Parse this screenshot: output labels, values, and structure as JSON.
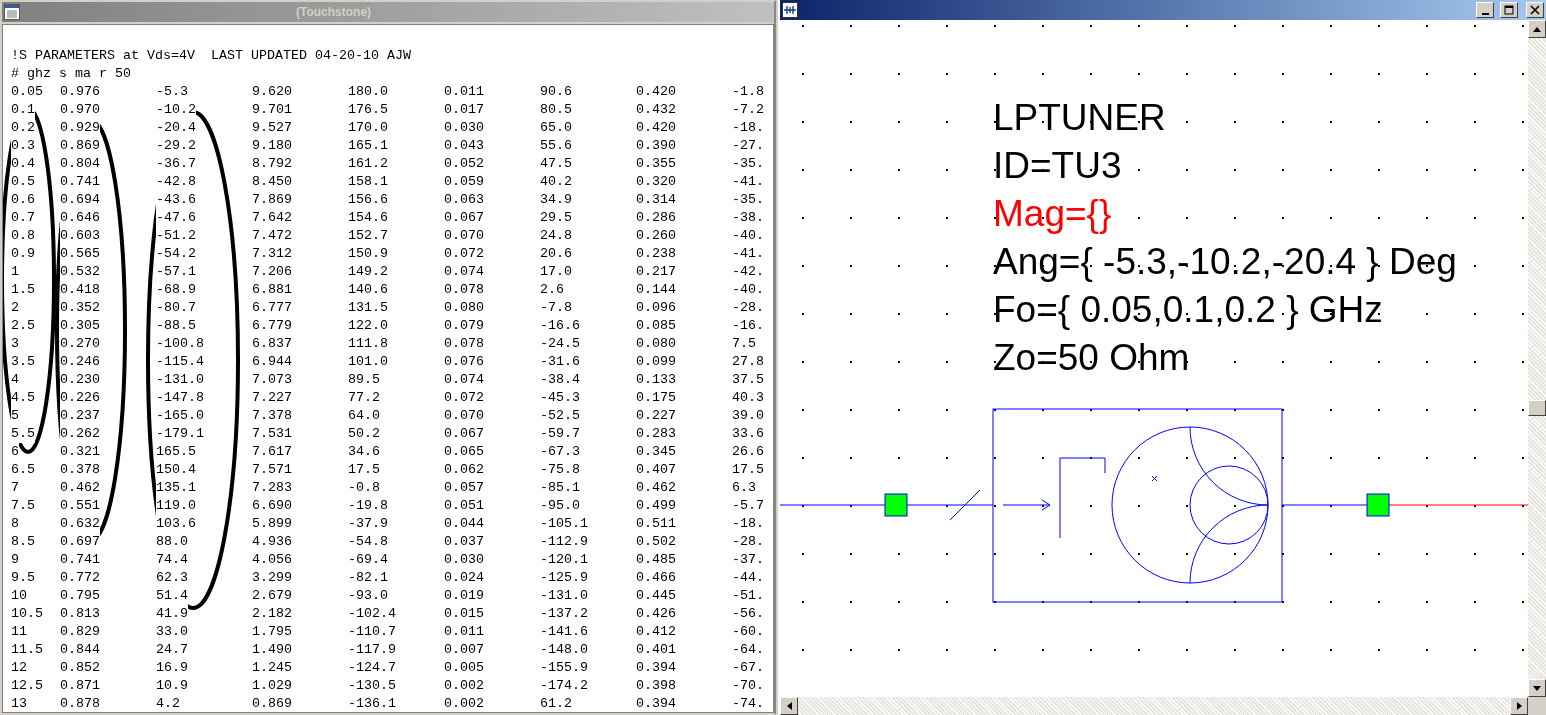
{
  "touchstone_window": {
    "title": "(Touchstone)",
    "active": false,
    "header_lines": [
      "!S PARAMETERS at Vds=4V  LAST UPDATED 04-20-10 AJW",
      "# ghz s ma r 50"
    ],
    "rows": [
      [
        "0.05",
        "0.976",
        "-5.3",
        "9.620",
        "180.0",
        "0.011",
        "90.6",
        "0.420",
        "-1.8"
      ],
      [
        "0.1",
        "0.970",
        "-10.2",
        "9.701",
        "176.5",
        "0.017",
        "80.5",
        "0.432",
        "-7.2"
      ],
      [
        "0.2",
        "0.929",
        "-20.4",
        "9.527",
        "170.0",
        "0.030",
        "65.0",
        "0.420",
        "-18."
      ],
      [
        "0.3",
        "0.869",
        "-29.2",
        "9.180",
        "165.1",
        "0.043",
        "55.6",
        "0.390",
        "-27."
      ],
      [
        "0.4",
        "0.804",
        "-36.7",
        "8.792",
        "161.2",
        "0.052",
        "47.5",
        "0.355",
        "-35."
      ],
      [
        "0.5",
        "0.741",
        "-42.8",
        "8.450",
        "158.1",
        "0.059",
        "40.2",
        "0.320",
        "-41."
      ],
      [
        "0.6",
        "0.694",
        "-43.6",
        "7.869",
        "156.6",
        "0.063",
        "34.9",
        "0.314",
        "-35."
      ],
      [
        "0.7",
        "0.646",
        "-47.6",
        "7.642",
        "154.6",
        "0.067",
        "29.5",
        "0.286",
        "-38."
      ],
      [
        "0.8",
        "0.603",
        "-51.2",
        "7.472",
        "152.7",
        "0.070",
        "24.8",
        "0.260",
        "-40."
      ],
      [
        "0.9",
        "0.565",
        "-54.2",
        "7.312",
        "150.9",
        "0.072",
        "20.6",
        "0.238",
        "-41."
      ],
      [
        "1",
        "0.532",
        "-57.1",
        "7.206",
        "149.2",
        "0.074",
        "17.0",
        "0.217",
        "-42."
      ],
      [
        "1.5",
        "0.418",
        "-68.9",
        "6.881",
        "140.6",
        "0.078",
        "2.6",
        "0.144",
        "-40."
      ],
      [
        "2",
        "0.352",
        "-80.7",
        "6.777",
        "131.5",
        "0.080",
        "-7.8",
        "0.096",
        "-28."
      ],
      [
        "2.5",
        "0.305",
        "-88.5",
        "6.779",
        "122.0",
        "0.079",
        "-16.6",
        "0.085",
        "-16."
      ],
      [
        "3",
        "0.270",
        "-100.8",
        "6.837",
        "111.8",
        "0.078",
        "-24.5",
        "0.080",
        "7.5"
      ],
      [
        "3.5",
        "0.246",
        "-115.4",
        "6.944",
        "101.0",
        "0.076",
        "-31.6",
        "0.099",
        "27.8"
      ],
      [
        "4",
        "0.230",
        "-131.0",
        "7.073",
        "89.5",
        "0.074",
        "-38.4",
        "0.133",
        "37.5"
      ],
      [
        "4.5",
        "0.226",
        "-147.8",
        "7.227",
        "77.2",
        "0.072",
        "-45.3",
        "0.175",
        "40.3"
      ],
      [
        "5",
        "0.237",
        "-165.0",
        "7.378",
        "64.0",
        "0.070",
        "-52.5",
        "0.227",
        "39.0"
      ],
      [
        "5.5",
        "0.262",
        "-179.1",
        "7.531",
        "50.2",
        "0.067",
        "-59.7",
        "0.283",
        "33.6"
      ],
      [
        "6",
        "0.321",
        "165.5",
        "7.617",
        "34.6",
        "0.065",
        "-67.3",
        "0.345",
        "26.6"
      ],
      [
        "6.5",
        "0.378",
        "150.4",
        "7.571",
        "17.5",
        "0.062",
        "-75.8",
        "0.407",
        "17.5"
      ],
      [
        "7",
        "0.462",
        "135.1",
        "7.283",
        "-0.8",
        "0.057",
        "-85.1",
        "0.462",
        "6.3"
      ],
      [
        "7.5",
        "0.551",
        "119.0",
        "6.690",
        "-19.8",
        "0.051",
        "-95.0",
        "0.499",
        "-5.7"
      ],
      [
        "8",
        "0.632",
        "103.6",
        "5.899",
        "-37.9",
        "0.044",
        "-105.1",
        "0.511",
        "-18."
      ],
      [
        "8.5",
        "0.697",
        "88.0",
        "4.936",
        "-54.8",
        "0.037",
        "-112.9",
        "0.502",
        "-28."
      ],
      [
        "9",
        "0.741",
        "74.4",
        "4.056",
        "-69.4",
        "0.030",
        "-120.1",
        "0.485",
        "-37."
      ],
      [
        "9.5",
        "0.772",
        "62.3",
        "3.299",
        "-82.1",
        "0.024",
        "-125.9",
        "0.466",
        "-44."
      ],
      [
        "10",
        "0.795",
        "51.4",
        "2.679",
        "-93.0",
        "0.019",
        "-131.0",
        "0.445",
        "-51."
      ],
      [
        "10.5",
        "0.813",
        "41.9",
        "2.182",
        "-102.4",
        "0.015",
        "-137.2",
        "0.426",
        "-56."
      ],
      [
        "11",
        "0.829",
        "33.0",
        "1.795",
        "-110.7",
        "0.011",
        "-141.6",
        "0.412",
        "-60."
      ],
      [
        "11.5",
        "0.844",
        "24.7",
        "1.490",
        "-117.9",
        "0.007",
        "-148.0",
        "0.401",
        "-64."
      ],
      [
        "12",
        "0.852",
        "16.9",
        "1.245",
        "-124.7",
        "0.005",
        "-155.9",
        "0.394",
        "-67."
      ],
      [
        "12.5",
        "0.871",
        "10.9",
        "1.029",
        "-130.5",
        "0.002",
        "-174.2",
        "0.398",
        "-70."
      ],
      [
        "13",
        "0.878",
        "4.2",
        "0.869",
        "-136.1",
        "0.002",
        "61.2",
        "0.394",
        "-74."
      ]
    ]
  },
  "schematic_window": {
    "active": true,
    "params": [
      {
        "text": "LPTUNER",
        "color": "#000000"
      },
      {
        "text": "ID=TU3",
        "color": "#000000"
      },
      {
        "text": "Mag={}",
        "color": "#ff0000"
      },
      {
        "text": "Ang={ -5.3,-10.2,-20.4 } Deg",
        "color": "#000000"
      },
      {
        "text": "Fo={ 0.05,0.1,0.2 } GHz",
        "color": "#000000"
      },
      {
        "text": "Zo=50 Ohm",
        "color": "#000000"
      }
    ]
  }
}
